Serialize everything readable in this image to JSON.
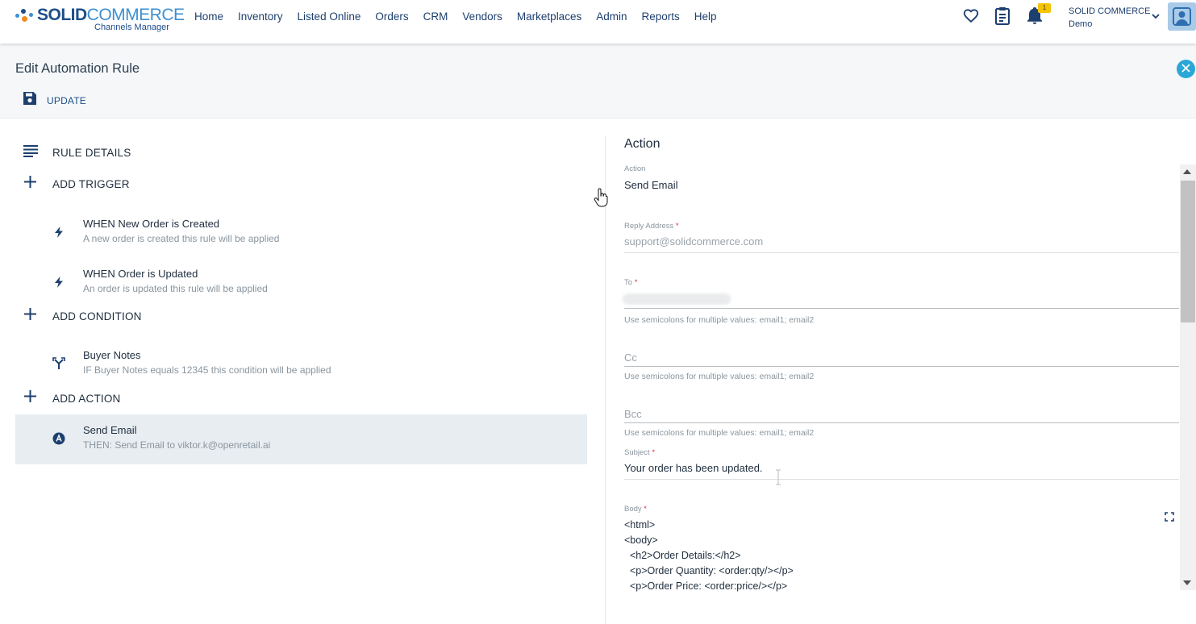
{
  "app": {
    "brand_bold": "SOLID",
    "brand_light": "COMMERCE",
    "subtitle": "Channels Manager",
    "nav": [
      "Home",
      "Inventory",
      "Listed Online",
      "Orders",
      "CRM",
      "Vendors",
      "Marketplaces",
      "Admin",
      "Reports",
      "Help"
    ],
    "notification_count": "1",
    "user_company": "SOLID COMMERCE",
    "user_name": "Demo",
    "icons": [
      "heart-icon",
      "clipboard-icon",
      "bell-icon",
      "chevron-down-icon",
      "avatar"
    ]
  },
  "header": {
    "title": "Edit Automation Rule",
    "update_label": "UPDATE"
  },
  "left": {
    "rule_details": "RULE DETAILS",
    "add_trigger": "ADD TRIGGER",
    "triggers": [
      {
        "title": "WHEN New Order is Created",
        "subtitle": "A new order is created this rule will be applied"
      },
      {
        "title": "WHEN Order is Updated",
        "subtitle": "An order is updated this rule will be applied"
      }
    ],
    "add_condition": "ADD CONDITION",
    "conditions": [
      {
        "title": "Buyer Notes",
        "subtitle": "IF Buyer Notes equals 12345 this condition will be applied"
      }
    ],
    "add_action": "ADD ACTION",
    "actions": [
      {
        "title": "Send Email",
        "subtitle": "THEN: Send Email to viktor.k@openretail.ai"
      }
    ]
  },
  "right": {
    "panel_title": "Action",
    "action_label": "Action",
    "action_value": "Send Email",
    "reply_label": "Reply Address",
    "reply_value": "support@solidcommerce.com",
    "to_label": "To",
    "to_hint": "Use semicolons for multiple values: email1; email2",
    "cc_placeholder": "Cc",
    "cc_hint": "Use semicolons for multiple values: email1; email2",
    "bcc_placeholder": "Bcc",
    "bcc_hint": "Use semicolons for multiple values: email1; email2",
    "subject_label": "Subject",
    "subject_value": "Your order has been updated.",
    "body_label": "Body",
    "required_mark": "*",
    "body_lines": [
      "<html>",
      "<body>",
      "  <h2>Order Details:</h2>",
      "  <p>Order Quantity: <order:qty/></p>",
      "  <p>Order Price: <order:price/></p>"
    ]
  },
  "colors": {
    "brand_dark": "#1d4e89",
    "brand_light": "#3d8fd1",
    "accent": "#2aa7d6",
    "required": "#e0303e",
    "selected_row": "#e8edf1"
  }
}
